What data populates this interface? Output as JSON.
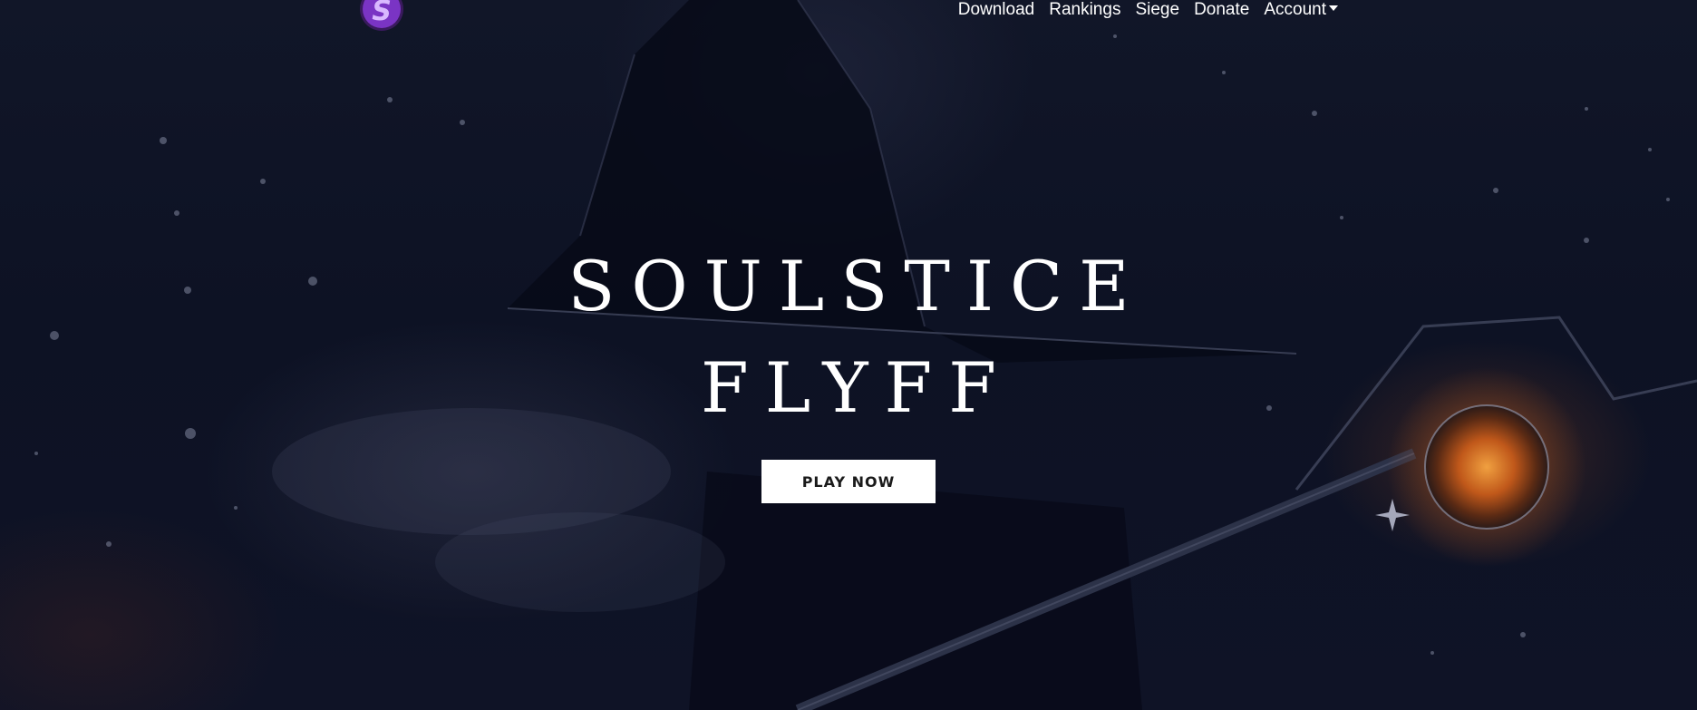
{
  "nav": {
    "logo": {
      "icon": "brand-logo-icon",
      "letter": "S",
      "color": "#8a3fd1"
    },
    "links": [
      {
        "label": "Download"
      },
      {
        "label": "Rankings"
      },
      {
        "label": "Siege"
      },
      {
        "label": "Donate"
      },
      {
        "label": "Account",
        "dropdown": true
      }
    ]
  },
  "hero": {
    "title_line1": "SOULSTICE",
    "title_line2": "FLYFF",
    "cta_label": "PLAY NOW"
  },
  "colors": {
    "background": "#0d1224",
    "text": "#ffffff",
    "button_bg": "#ffffff",
    "button_text": "#1a1a1a",
    "orb_glow": "#e0761c",
    "logo_purple": "#8a3fd1"
  }
}
